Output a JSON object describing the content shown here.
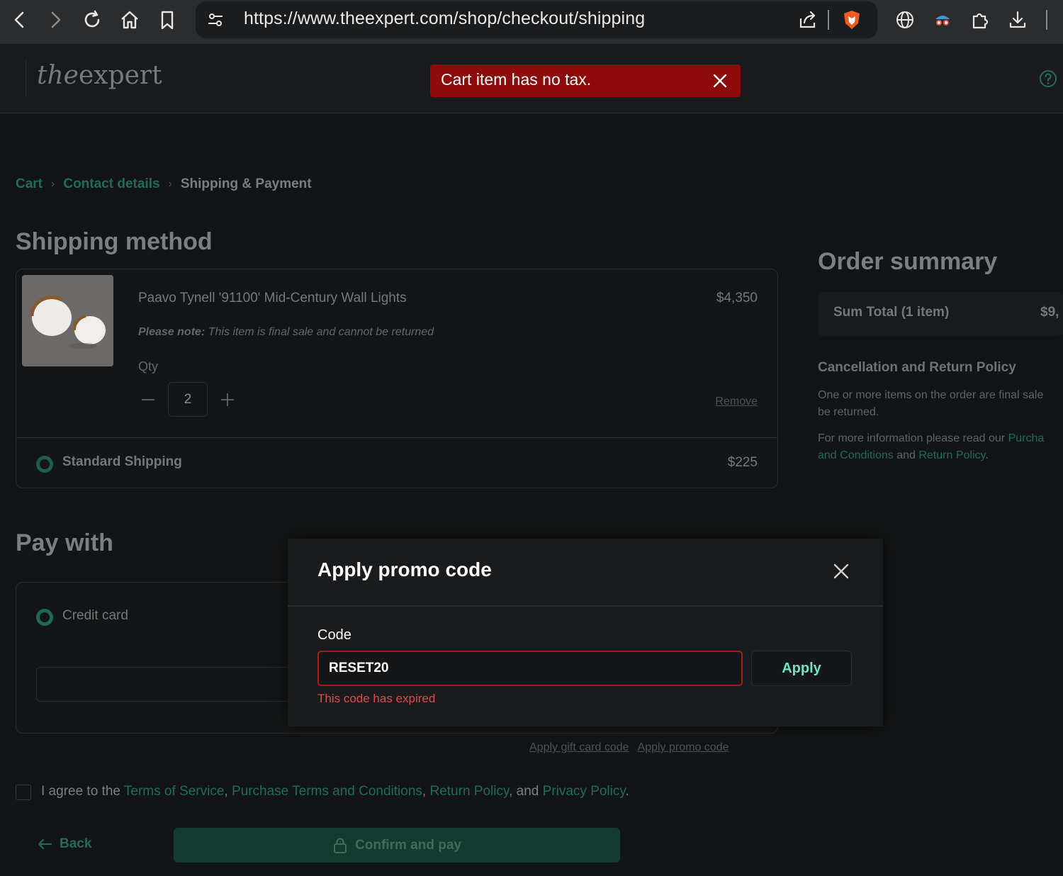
{
  "browser": {
    "url": "https://www.theexpert.com/shop/checkout/shipping"
  },
  "header": {
    "logo_italic": "the",
    "logo_rest": "expert",
    "toast_message": "Cart item has no tax."
  },
  "breadcrumb": {
    "items": [
      "Cart",
      "Contact details",
      "Shipping & Payment"
    ]
  },
  "shipping": {
    "title": "Shipping method",
    "product_name": "Paavo Tynell '91100' Mid-Century Wall Lights",
    "product_price": "$4,350",
    "note_bold": "Please note:",
    "note_text": " This item is final sale and cannot be returned",
    "qty_label": "Qty",
    "qty_value": "2",
    "remove_label": "Remove",
    "option_label": "Standard Shipping",
    "option_price": "$225"
  },
  "summary": {
    "title": "Order summary",
    "sum_label": "Sum Total (1 item)",
    "sum_value": "$9,",
    "policy_title": "Cancellation and Return Policy",
    "policy_line1": "One or more items on the order are final sale",
    "policy_line2": "be returned.",
    "policy_info_prefix": "For more information please read our ",
    "policy_link_purchase": "Purcha",
    "policy_link_purchase2": "and Conditions",
    "policy_and": " and ",
    "policy_link_return": "Return Policy",
    "policy_period": "."
  },
  "payment": {
    "title": "Pay with",
    "credit_card_label": "Credit card",
    "gift_card_link": "Apply gift card code",
    "promo_link": "Apply promo code"
  },
  "agreement": {
    "prefix": "I agree to the ",
    "terms": "Terms of Service",
    "comma1": ", ",
    "purchase_terms": "Purchase Terms and Conditions",
    "comma2": ", ",
    "return_policy": "Return Policy",
    "and": ", and ",
    "privacy": "Privacy Policy",
    "period": "."
  },
  "footer": {
    "back_label": "Back",
    "confirm_label": "Confirm and pay"
  },
  "modal": {
    "title": "Apply promo code",
    "code_label": "Code",
    "code_value": "RESET20",
    "apply_label": "Apply",
    "error": "This code has expired"
  },
  "colors": {
    "accent": "#1f6c57",
    "error_toast": "#8d0b0b",
    "error_text": "#e24b4b",
    "apply_text": "#6fe3c3"
  }
}
